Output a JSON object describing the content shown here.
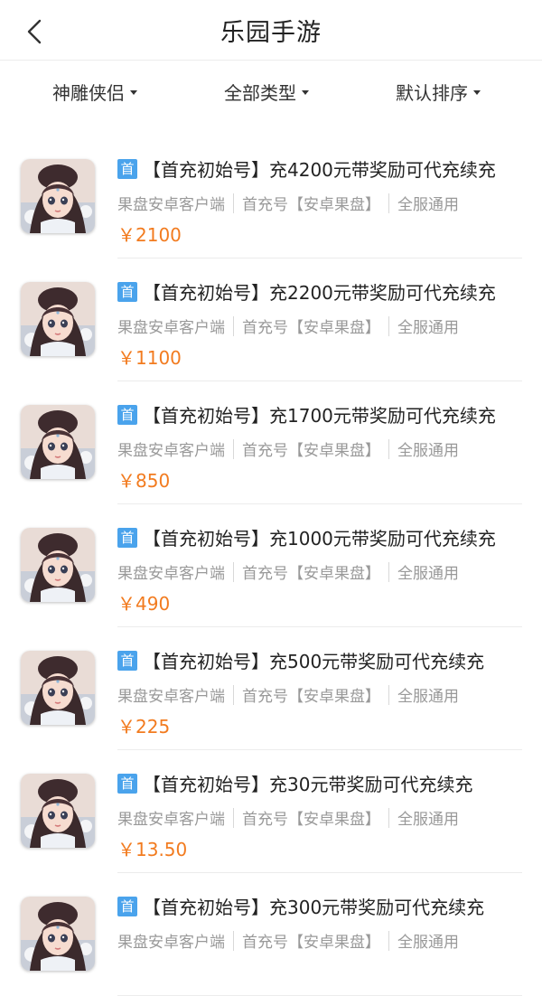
{
  "header": {
    "title": "乐园手游"
  },
  "filters": {
    "game": "神雕侠侣",
    "type": "全部类型",
    "sort": "默认排序"
  },
  "items": [
    {
      "badge": "首",
      "name": "【首充初始号】充4200元带奖励可代充续充",
      "tag1": "果盘安卓客户端",
      "tag2": "首充号【安卓果盘】",
      "tag3": "全服通用",
      "price": "￥2100"
    },
    {
      "badge": "首",
      "name": "【首充初始号】充2200元带奖励可代充续充",
      "tag1": "果盘安卓客户端",
      "tag2": "首充号【安卓果盘】",
      "tag3": "全服通用",
      "price": "￥1100"
    },
    {
      "badge": "首",
      "name": "【首充初始号】充1700元带奖励可代充续充",
      "tag1": "果盘安卓客户端",
      "tag2": "首充号【安卓果盘】",
      "tag3": "全服通用",
      "price": "￥850"
    },
    {
      "badge": "首",
      "name": "【首充初始号】充1000元带奖励可代充续充",
      "tag1": "果盘安卓客户端",
      "tag2": "首充号【安卓果盘】",
      "tag3": "全服通用",
      "price": "￥490"
    },
    {
      "badge": "首",
      "name": "【首充初始号】充500元带奖励可代充续充",
      "tag1": "果盘安卓客户端",
      "tag2": "首充号【安卓果盘】",
      "tag3": "全服通用",
      "price": "￥225"
    },
    {
      "badge": "首",
      "name": "【首充初始号】充30元带奖励可代充续充",
      "tag1": "果盘安卓客户端",
      "tag2": "首充号【安卓果盘】",
      "tag3": "全服通用",
      "price": "￥13.50"
    },
    {
      "badge": "首",
      "name": "【首充初始号】充300元带奖励可代充续充",
      "tag1": "果盘安卓客户端",
      "tag2": "首充号【安卓果盘】",
      "tag3": "全服通用",
      "price": ""
    }
  ],
  "colors": {
    "price": "#f27b1f",
    "badge": "#4aa3ec",
    "muted": "#999999"
  },
  "icons": {
    "back": "chevron-left-icon",
    "dropdown": "caret-down-icon"
  }
}
